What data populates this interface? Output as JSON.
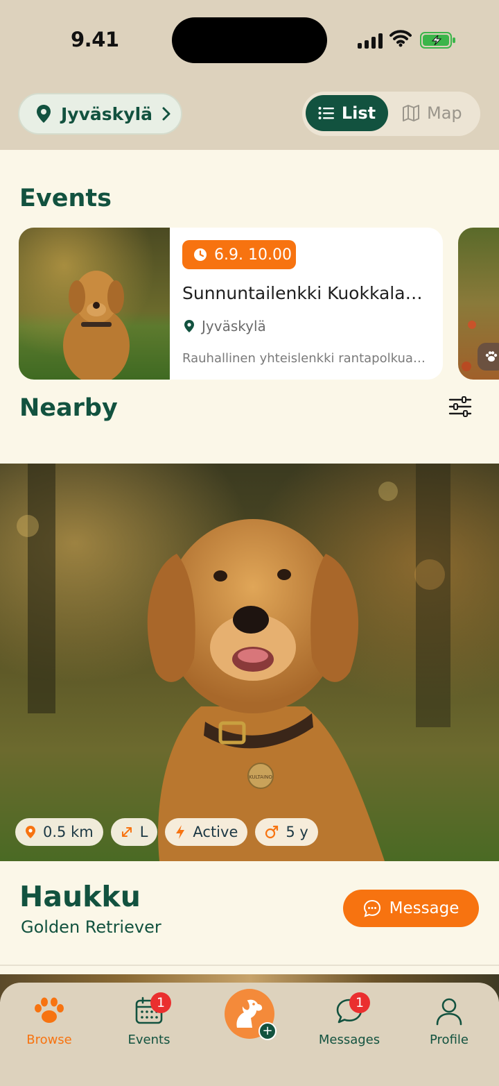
{
  "status_bar": {
    "time": "9.41"
  },
  "header": {
    "location": "Jyväskylä",
    "view_toggle": {
      "list_label": "List",
      "map_label": "Map",
      "selected": "List"
    }
  },
  "events": {
    "title": "Events",
    "items": [
      {
        "date": "6.9. 10.00",
        "title": "Sunnuntailenkki Kuokkala…",
        "location": "Jyväskylä",
        "description": "Rauhallinen yhteislenkki rantapolkua…"
      }
    ]
  },
  "nearby": {
    "title": "Nearby",
    "dog": {
      "name": "Haukku",
      "breed": "Golden Retriever",
      "tag_text": "KULTAINO",
      "chips": {
        "distance": "0.5 km",
        "size": "L",
        "energy": "Active",
        "age": "5 y"
      },
      "message_label": "Message"
    }
  },
  "bottom_nav": {
    "items": [
      {
        "label": "Browse",
        "icon": "paw-icon",
        "active": true
      },
      {
        "label": "Events",
        "icon": "calendar-icon",
        "badge": "1"
      },
      {
        "label": "",
        "icon": "add-dog-icon"
      },
      {
        "label": "Messages",
        "icon": "chat-icon",
        "badge": "1"
      },
      {
        "label": "Profile",
        "icon": "user-icon"
      }
    ]
  },
  "colors": {
    "primary": "#12523f",
    "accent": "#f77310",
    "background": "#fbf7e8",
    "header": "#ddd2bd",
    "badge": "#ea2f2f"
  }
}
